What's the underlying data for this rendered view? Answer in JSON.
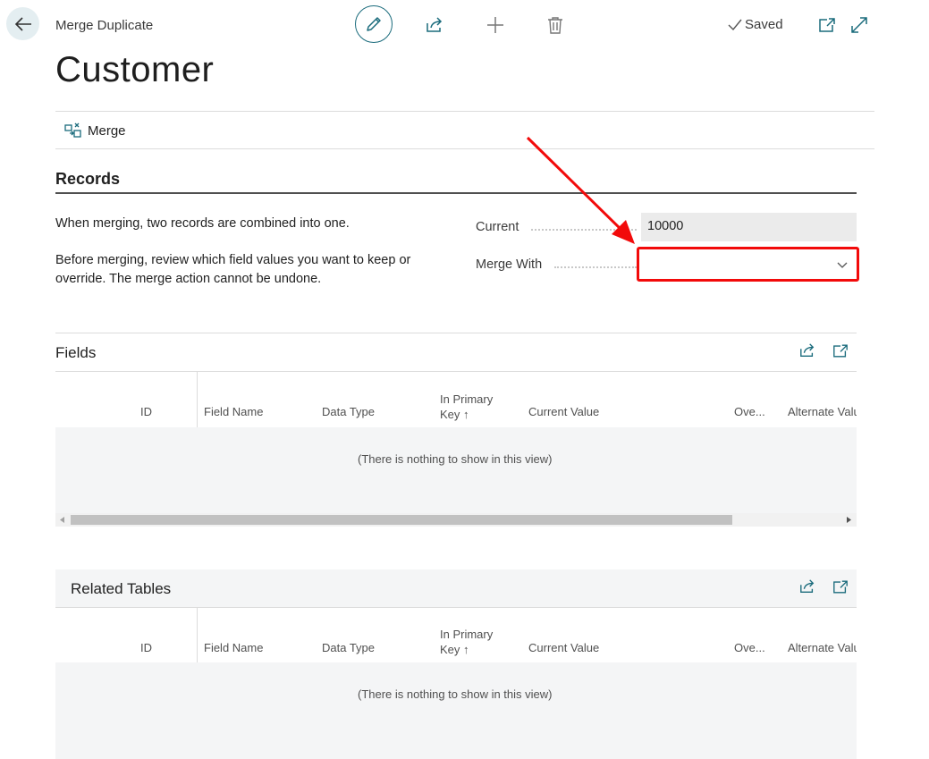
{
  "header": {
    "breadcrumb": "Merge Duplicate",
    "saved_label": "Saved",
    "title": "Customer"
  },
  "actions": {
    "merge_label": "Merge"
  },
  "records": {
    "title": "Records",
    "description_1": "When merging, two records are combined into one.",
    "description_2": "Before merging, review which field values you want to keep or override. The merge action cannot be undone.",
    "current_label": "Current",
    "current_value": "10000",
    "merge_with_label": "Merge With",
    "merge_with_value": ""
  },
  "fields_part": {
    "title": "Fields",
    "columns": [
      "ID",
      "Field Name",
      "Data Type",
      "In Primary",
      "Key",
      "Current Value",
      "Ove...",
      "Alternate Valu"
    ],
    "empty_message": "(There is nothing to show in this view)"
  },
  "related_part": {
    "title": "Related Tables",
    "columns": [
      "ID",
      "Field Name",
      "Data Type",
      "In Primary",
      "Key",
      "Current Value",
      "Ove...",
      "Alternate Valu"
    ],
    "empty_message": "(There is nothing to show in this view)"
  },
  "colors": {
    "accent": "#1a6b7c",
    "highlight": "#f20a0a"
  }
}
